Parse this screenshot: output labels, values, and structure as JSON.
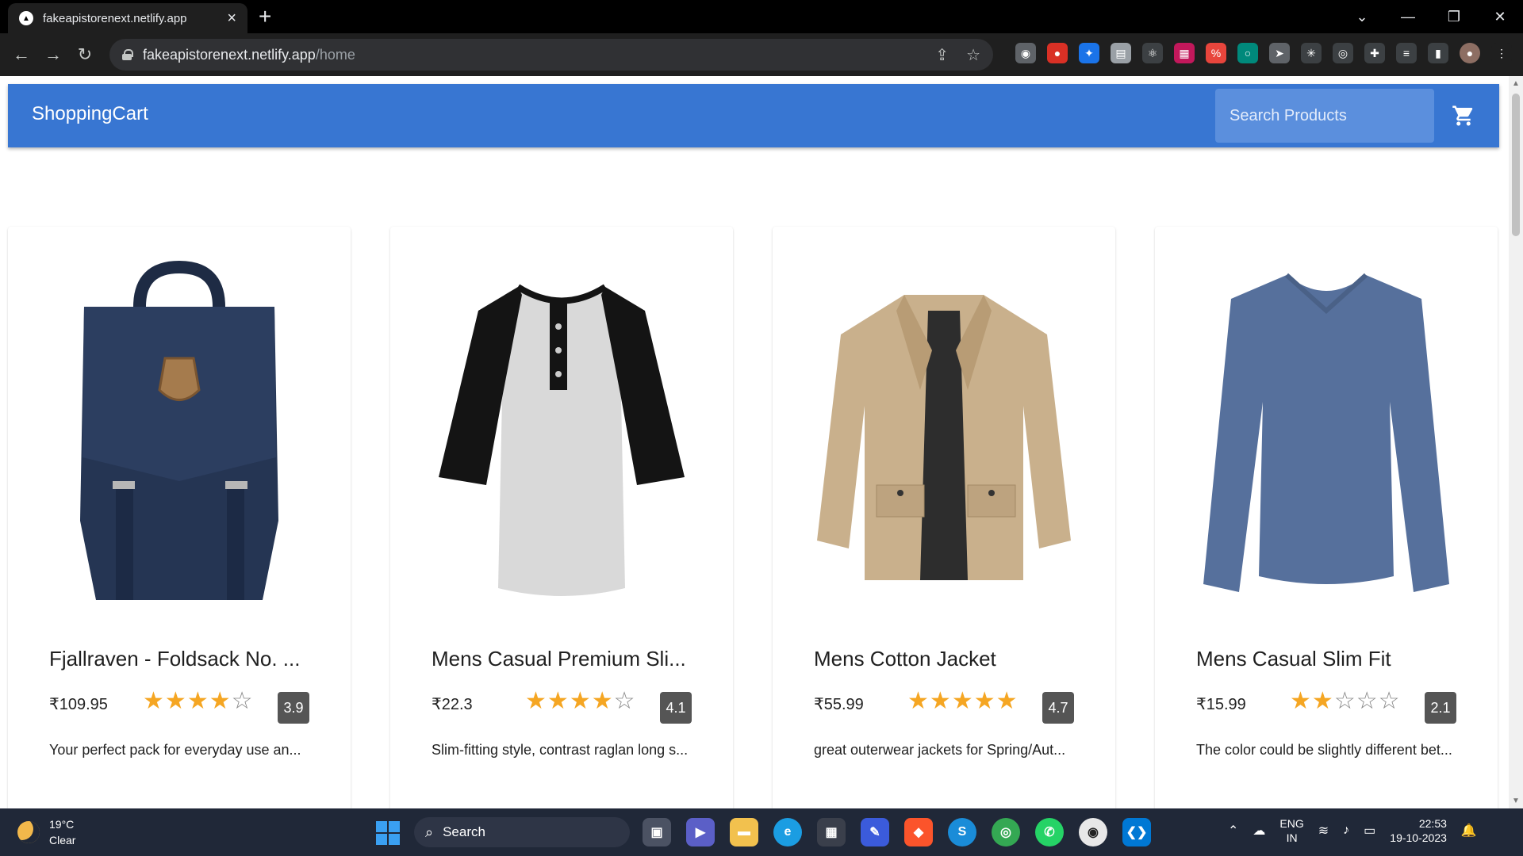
{
  "browser": {
    "tab_title": "fakeapistorenext.netlify.app",
    "new_tab_symbol": "+",
    "url_host": "fakeapistorenext.netlify.app",
    "url_path": "/home"
  },
  "app": {
    "brand": "ShoppingCart",
    "search_placeholder": "Search Products",
    "accent_color": "#3876d2"
  },
  "products": [
    {
      "title": "Fjallraven - Foldsack No. ...",
      "price": "₹109.95",
      "rating": "3.9",
      "stars_filled": 4,
      "description": "Your perfect pack for everyday use an..."
    },
    {
      "title": "Mens Casual Premium Sli...",
      "price": "₹22.3",
      "rating": "4.1",
      "stars_filled": 4,
      "description": "Slim-fitting style, contrast raglan long s..."
    },
    {
      "title": "Mens Cotton Jacket",
      "price": "₹55.99",
      "rating": "4.7",
      "stars_filled": 5,
      "description": "great outerwear jackets for Spring/Aut..."
    },
    {
      "title": "Mens Casual Slim Fit",
      "price": "₹15.99",
      "rating": "2.1",
      "stars_filled": 2,
      "description": "The color could be slightly different bet..."
    }
  ],
  "taskbar": {
    "temperature": "19°C",
    "condition": "Clear",
    "search_label": "Search",
    "lang_line1": "ENG",
    "lang_line2": "IN",
    "time": "22:53",
    "date": "19-10-2023"
  }
}
